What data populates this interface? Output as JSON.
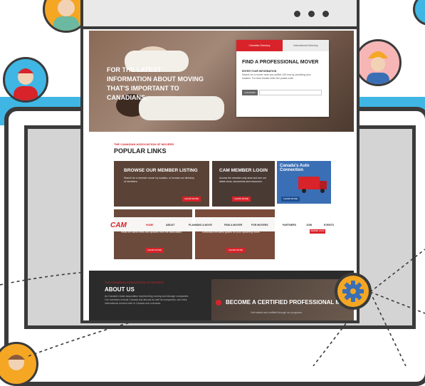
{
  "browser": {
    "controls": [
      "•",
      "•",
      "•"
    ]
  },
  "hero": {
    "headline": "For the latest information about moving that's important to Canadians."
  },
  "finder": {
    "tab_canadian": "Canadian Directory",
    "tab_international": "International Directory",
    "title": "FIND A PROFESSIONAL MOVER",
    "subtitle": "ENTER YOUR INFORMATION",
    "description": "Search for a mover near you (within 100 km) by providing your location. For best results enter the postal code.",
    "button_label": "LOCATION",
    "input_placeholder": ""
  },
  "popular": {
    "eyebrow": "THE CANADIAN ASSOCIATION OF MOVERS",
    "title": "POPULAR LINKS",
    "cards": [
      {
        "title": "BROWSE OUR MEMBER LISTING",
        "text": "Search for a member mover by location, or browse our directory of members.",
        "button": "LEARN MORE"
      },
      {
        "title": "CAM MEMBER LOGIN",
        "text": "Access the member-only area and see our latest news, documents and resources.",
        "button": "LEARN MORE"
      },
      {
        "title": "",
        "text": "Read the latest news and updates from the association.",
        "button": "LEARN MORE"
      },
      {
        "title": "",
        "text": "Download the latest guides for your upcoming move.",
        "button": "LEARN MORE"
      }
    ],
    "ad": {
      "title": "Canada's Auto Connection",
      "button": "LEARN MORE"
    }
  },
  "nav": {
    "logo": "CAM",
    "items": [
      "HOME",
      "ABOUT",
      "PLANNING A MOVE",
      "FIND A MOVER",
      "FOR MOVERS",
      "PARTNERS",
      "JOIN",
      "EVENTS"
    ],
    "cta": "MEMBER LOGIN"
  },
  "footer": {
    "eyebrow": "THE CANADIAN ASSOCIATION OF MOVERS",
    "about_title": "ABOUT US",
    "about_text": "As Canada's trade association representing moving and storage companies. Our members include Canada and abroad as well as companies, van lines, international movers both in Canada and overseas.",
    "certified_title": "BECOME A CERTIFIED PROFESSIONAL MOVER",
    "certified_text": "Get trained and certified through our programs."
  }
}
